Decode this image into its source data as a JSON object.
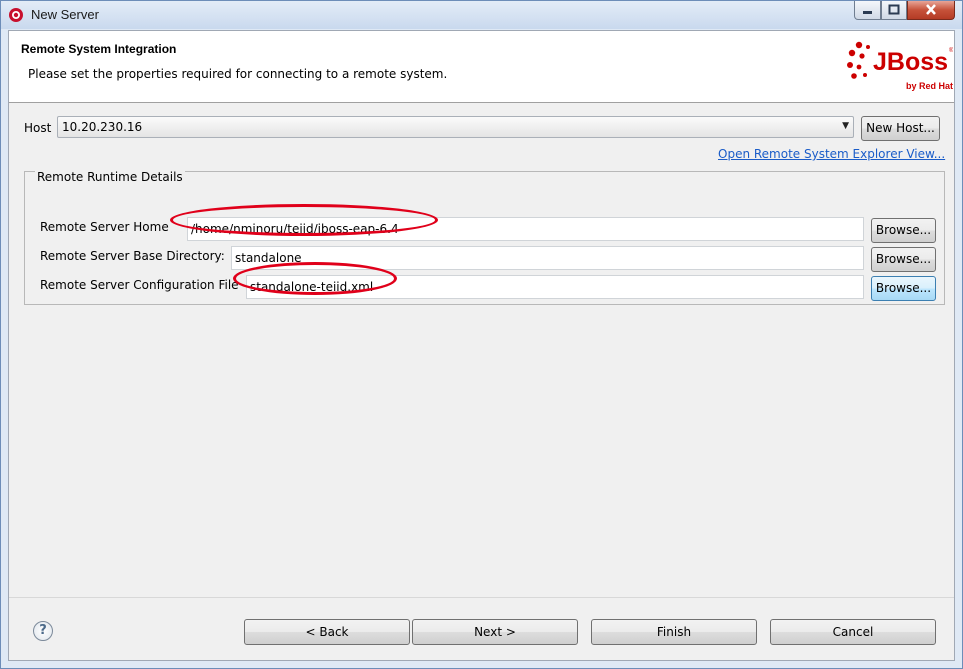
{
  "window": {
    "title": "New Server"
  },
  "header": {
    "title": "Remote System Integration",
    "description": "Please set the properties required for connecting to a remote system.",
    "logo": {
      "brand": "JBoss",
      "tagline": "by Red Hat",
      "color": "#cc0000"
    }
  },
  "host": {
    "label": "Host",
    "value": "10.20.230.16",
    "new_host_label": "New Host..."
  },
  "explorer_link": "Open Remote System Explorer View...",
  "runtime": {
    "group_title": "Remote Runtime Details",
    "home_label": "Remote Server Home",
    "home_value": "/home/nminoru/teiid/jboss-eap-6.4",
    "base_dir_label": "Remote Server Base Directory:",
    "base_dir_value": "standalone",
    "config_label": "Remote Server Configuration File",
    "config_value": "standalone-teiid.xml",
    "browse_label": "Browse..."
  },
  "buttons": {
    "back": "< Back",
    "next": "Next >",
    "finish": "Finish",
    "cancel": "Cancel"
  },
  "colors": {
    "annotation": "#e0001a",
    "link": "#1a5cc8"
  }
}
